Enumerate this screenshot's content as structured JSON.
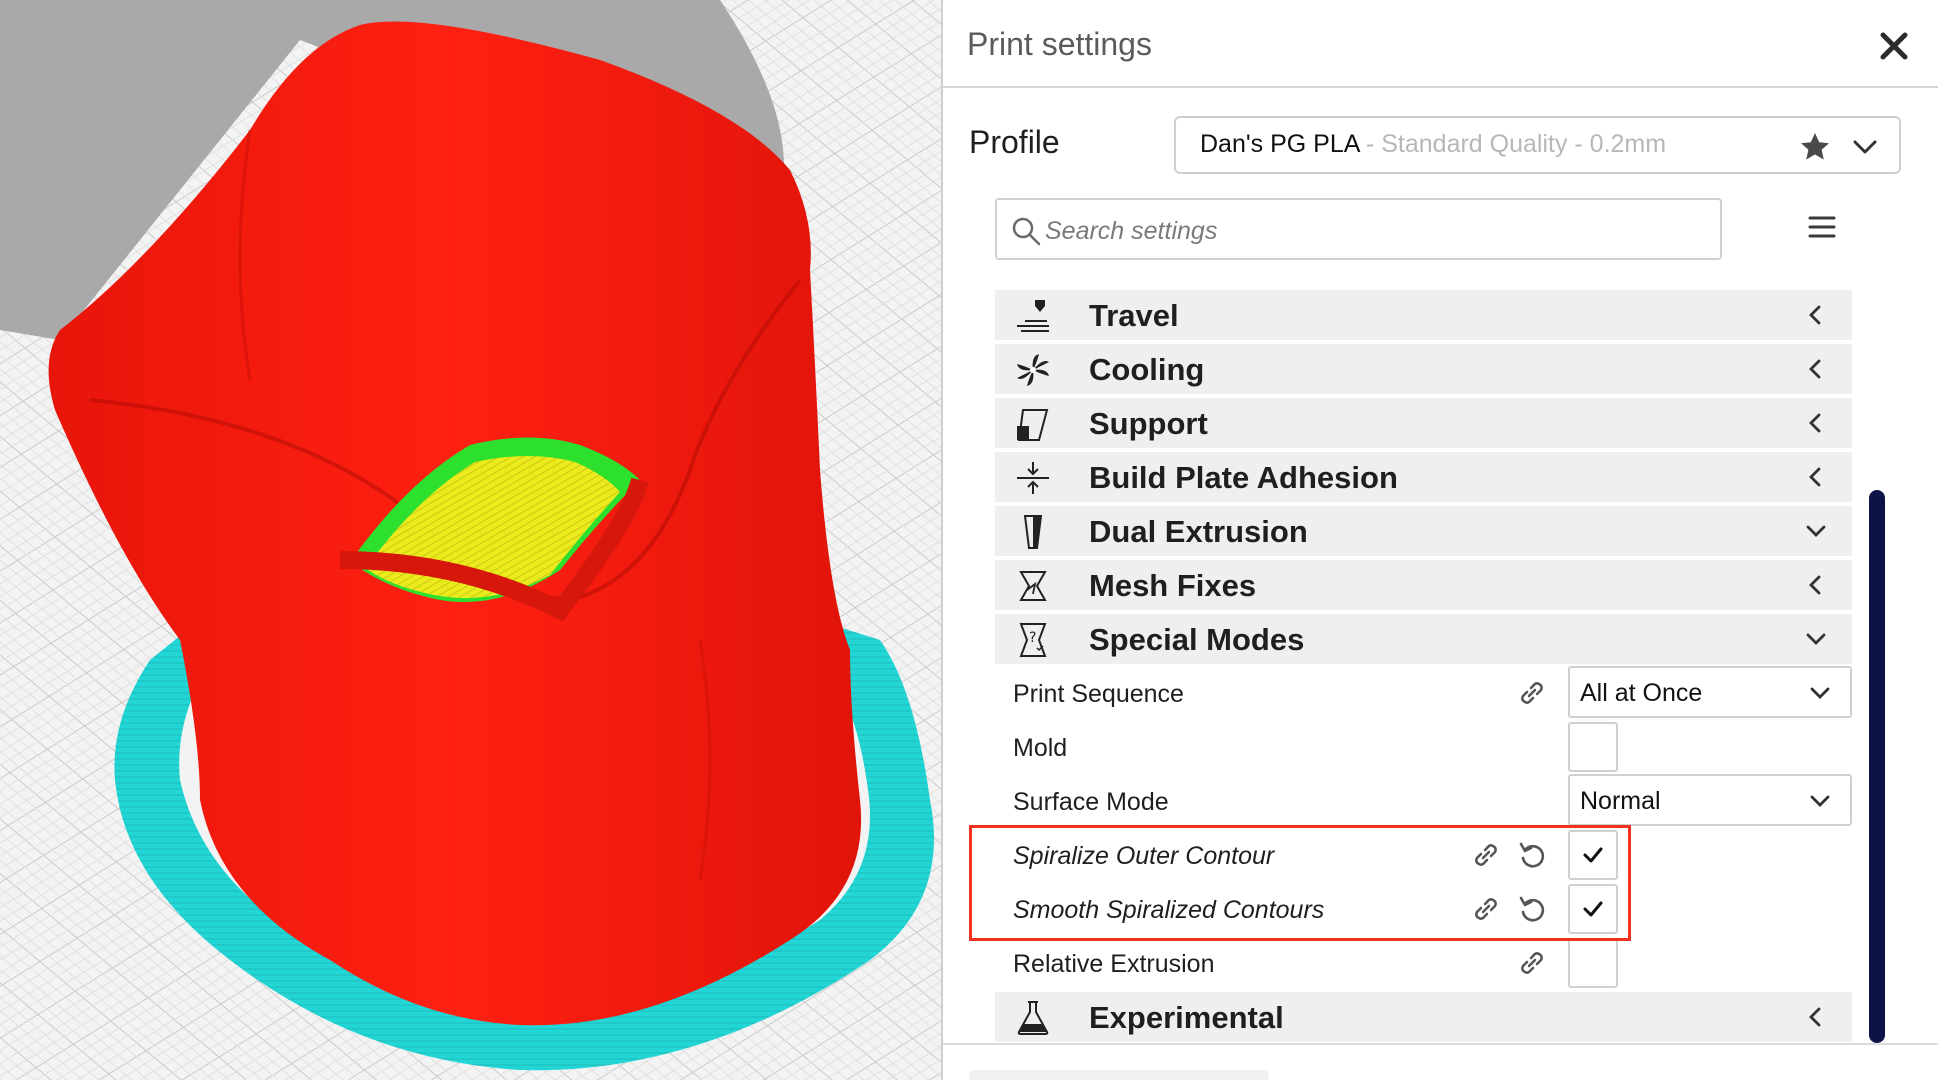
{
  "panel": {
    "title": "Print settings",
    "close_icon": "close-icon"
  },
  "profile": {
    "label": "Profile",
    "name": "Dan's PG PLA",
    "quality": " - Standard Quality - 0.2mm",
    "star_icon": "star-icon",
    "chevron_icon": "chevron-down-icon"
  },
  "search": {
    "placeholder": "Search settings",
    "value": ""
  },
  "categories": [
    {
      "label": "Travel",
      "icon": "travel-icon",
      "expanded": false
    },
    {
      "label": "Cooling",
      "icon": "cooling-fan-icon",
      "expanded": false
    },
    {
      "label": "Support",
      "icon": "support-icon",
      "expanded": false
    },
    {
      "label": "Build Plate Adhesion",
      "icon": "build-plate-adhesion-icon",
      "expanded": false
    },
    {
      "label": "Dual Extrusion",
      "icon": "dual-extrusion-icon",
      "expanded": true
    },
    {
      "label": "Mesh Fixes",
      "icon": "mesh-fixes-icon",
      "expanded": false
    },
    {
      "label": "Special Modes",
      "icon": "special-modes-icon",
      "expanded": true
    },
    {
      "label": "Experimental",
      "icon": "experimental-flask-icon",
      "expanded": false
    }
  ],
  "special_modes": [
    {
      "label": "Print Sequence",
      "control": "dropdown",
      "value": "All at Once",
      "linked": true,
      "reset": false,
      "italic": false
    },
    {
      "label": "Mold",
      "control": "checkbox",
      "checked": false,
      "linked": false,
      "reset": false,
      "italic": false
    },
    {
      "label": "Surface Mode",
      "control": "dropdown",
      "value": "Normal",
      "linked": false,
      "reset": false,
      "italic": false
    },
    {
      "label": "Spiralize Outer Contour",
      "control": "checkbox",
      "checked": true,
      "linked": true,
      "reset": true,
      "italic": true
    },
    {
      "label": "Smooth Spiralized Contours",
      "control": "checkbox",
      "checked": true,
      "linked": true,
      "reset": true,
      "italic": true
    },
    {
      "label": "Relative Extrusion",
      "control": "checkbox",
      "checked": false,
      "linked": true,
      "reset": false,
      "italic": false
    }
  ],
  "colors": {
    "highlight": "#f0331f",
    "scrollbar": "#0d1247",
    "model_shell": "#ff1a0e",
    "model_top": "#e6e61a",
    "model_inner_wall": "#2ee02e",
    "brim": "#22d6d6",
    "shadow": "#a9a9a9"
  }
}
